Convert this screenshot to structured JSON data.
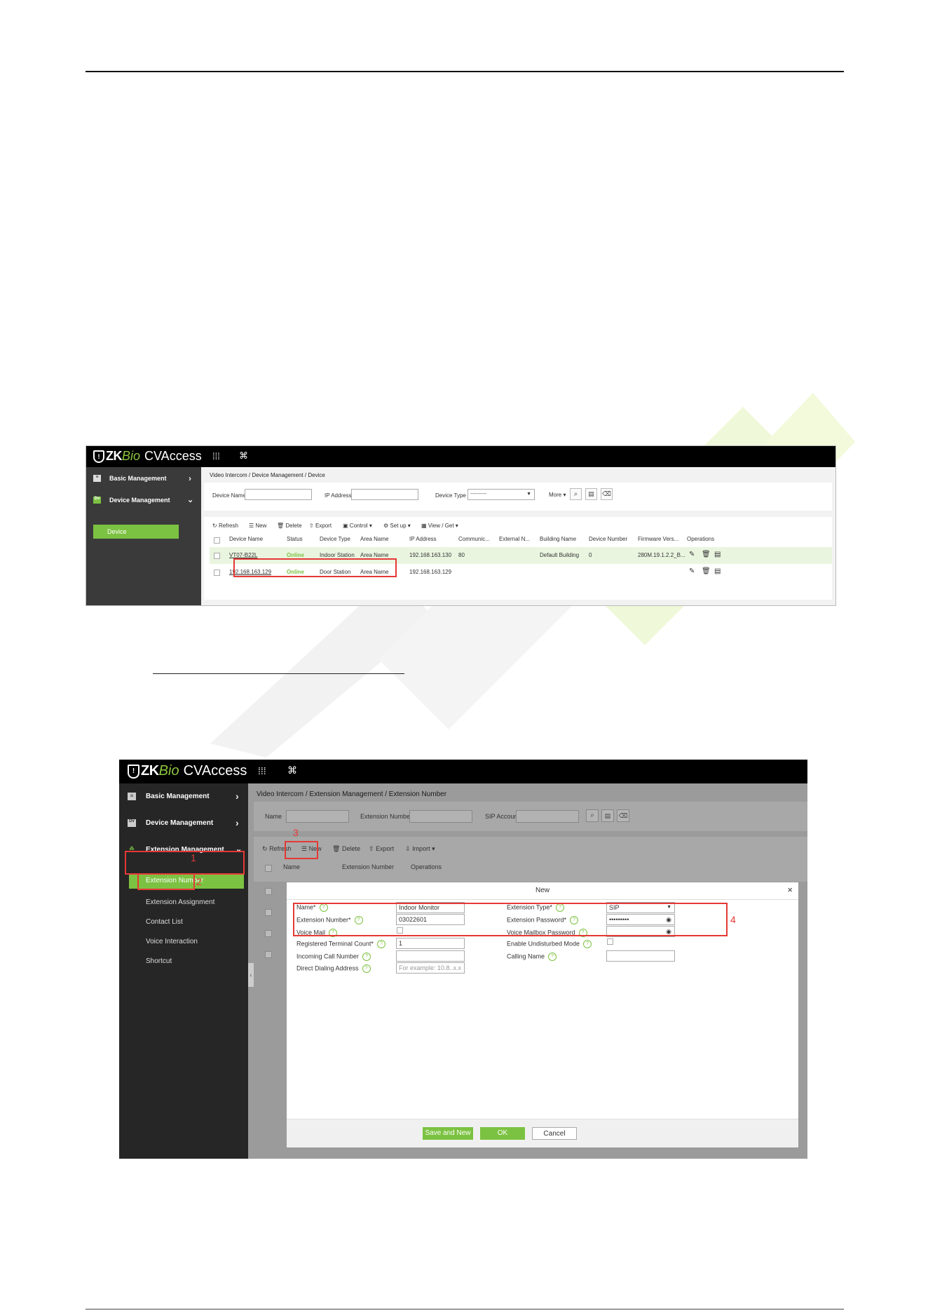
{
  "shot1": {
    "logo": {
      "zk": "ZK",
      "bio": "Bio",
      "cv": "CVAccess"
    },
    "top_icons": [
      "grid-icon",
      "command-icon"
    ],
    "sidebar": [
      {
        "label": "Basic Management",
        "chevron": "›"
      },
      {
        "label": "Device Management",
        "chevron": "⌄"
      }
    ],
    "sidebar_active": "Device",
    "breadcrumb": "Video Intercom / Device Management / Device",
    "filters": {
      "device_name": "Device Name",
      "ip_address": "IP Address",
      "device_type": "Device Type",
      "device_type_value": "----------",
      "more": "More"
    },
    "toolbar": [
      "Refresh",
      "New",
      "Delete",
      "Export",
      "Control",
      "Set up",
      "View / Get"
    ],
    "columns": [
      "Device Name",
      "Status",
      "Device Type",
      "Area Name",
      "IP Address",
      "Communic...",
      "External N...",
      "Building Name",
      "Device Number",
      "Firmware Vers...",
      "Operations"
    ],
    "rows": [
      {
        "device_name": "VT07-B22L",
        "status": "Online",
        "device_type": "Indoor Station",
        "area_name": "Area Name",
        "ip": "192.168.163.130",
        "comm": "80",
        "external": "",
        "building": "Default Building",
        "number": "0",
        "firmware": "280M.19.1.2.2_B..."
      },
      {
        "device_name": "192.168.163.129",
        "status": "Online",
        "device_type": "Door Station",
        "area_name": "Area Name",
        "ip": "192.168.163.129",
        "comm": "",
        "external": "",
        "building": "",
        "number": "",
        "firmware": ""
      }
    ]
  },
  "shot2": {
    "logo": {
      "zk": "ZK",
      "bio": "Bio",
      "cv": "CVAccess"
    },
    "sidebar": [
      {
        "label": "Basic Management",
        "chevron": "›"
      },
      {
        "label": "Device Management",
        "chevron": "›"
      },
      {
        "label": "Extension Management",
        "chevron": "⌄"
      }
    ],
    "submenu": [
      "Extension Number",
      "Extension Assignment",
      "Contact List",
      "Voice Interaction",
      "Shortcut"
    ],
    "breadcrumb": "Video Intercom / Extension Management / Extension Number",
    "filters": {
      "name": "Name",
      "extension_number": "Extension Number",
      "sip_account": "SIP Account"
    },
    "toolbar": [
      "Refresh",
      "New",
      "Delete",
      "Export",
      "Import"
    ],
    "columns": [
      "Name",
      "Extension Number",
      "Operations"
    ],
    "modal": {
      "title": "New",
      "close": "×",
      "left": [
        {
          "label": "Name*",
          "value": "Indoor Monitor"
        },
        {
          "label": "Extension Number*",
          "value": "03022601"
        },
        {
          "label": "Voice Mail",
          "value": ""
        },
        {
          "label": "Registered Terminal Count*",
          "value": "1"
        },
        {
          "label": "Incoming Call Number",
          "value": ""
        },
        {
          "label": "Direct Dialing Address",
          "value": "For example: 10.8..x.x"
        }
      ],
      "right": [
        {
          "label": "Extension Type*",
          "value": "SIP"
        },
        {
          "label": "Extension Password*",
          "value": "•••••••••"
        },
        {
          "label": "Voice Mailbox Password",
          "value": ""
        },
        {
          "label": "Enable Undisturbed Mode",
          "value": ""
        },
        {
          "label": "Calling Name",
          "value": ""
        }
      ],
      "buttons": {
        "save_new": "Save and New",
        "ok": "OK",
        "cancel": "Cancel"
      }
    },
    "markers": [
      "1",
      "2",
      "3",
      "4"
    ]
  },
  "colors": {
    "accent": "#7cc242",
    "annotation": "#e53935",
    "topbar": "#000000"
  }
}
